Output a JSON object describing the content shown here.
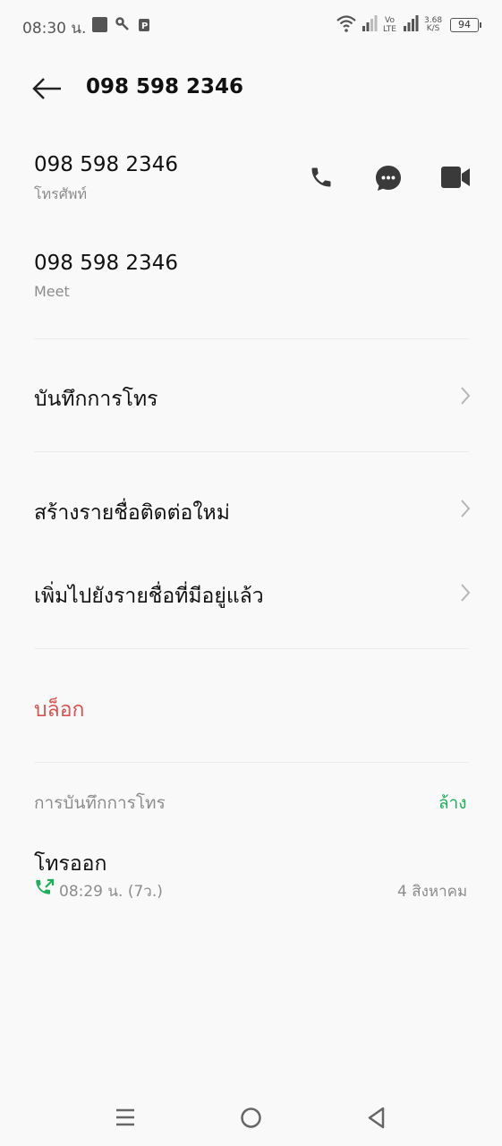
{
  "status_bar": {
    "time": "08:30 น.",
    "volte_top": "Vo",
    "volte_bottom": "LTE",
    "speed_value": "3.68",
    "speed_unit": "K/S",
    "battery": "94"
  },
  "header": {
    "title": "098 598 2346"
  },
  "phone_entry": {
    "number": "098 598 2346",
    "type_label": "โทรศัพท์"
  },
  "meet_entry": {
    "number": "098 598 2346",
    "type_label": "Meet"
  },
  "menu": {
    "call_history": "บันทึกการโทร",
    "create_contact": "สร้างรายชื่อติดต่อใหม่",
    "add_existing": "เพิ่มไปยังรายชื่อที่มีอยู่แล้ว",
    "block": "บล็อก"
  },
  "call_log": {
    "section_title": "การบันทึกการโทร",
    "clear_label": "ล้าง",
    "entries": [
      {
        "type": "โทรออก",
        "time": "08:29 น.  (7ว.)",
        "date": "4 สิงหาคม"
      }
    ]
  },
  "colors": {
    "background": "#f9f9f9",
    "block_red": "#d9534f",
    "accent_green": "#1fae5d"
  },
  "icons": {
    "back": "arrow-left-icon",
    "call": "phone-icon",
    "message": "chat-bubble-icon",
    "video": "video-camera-icon",
    "outgoing_call": "outgoing-call-icon"
  }
}
